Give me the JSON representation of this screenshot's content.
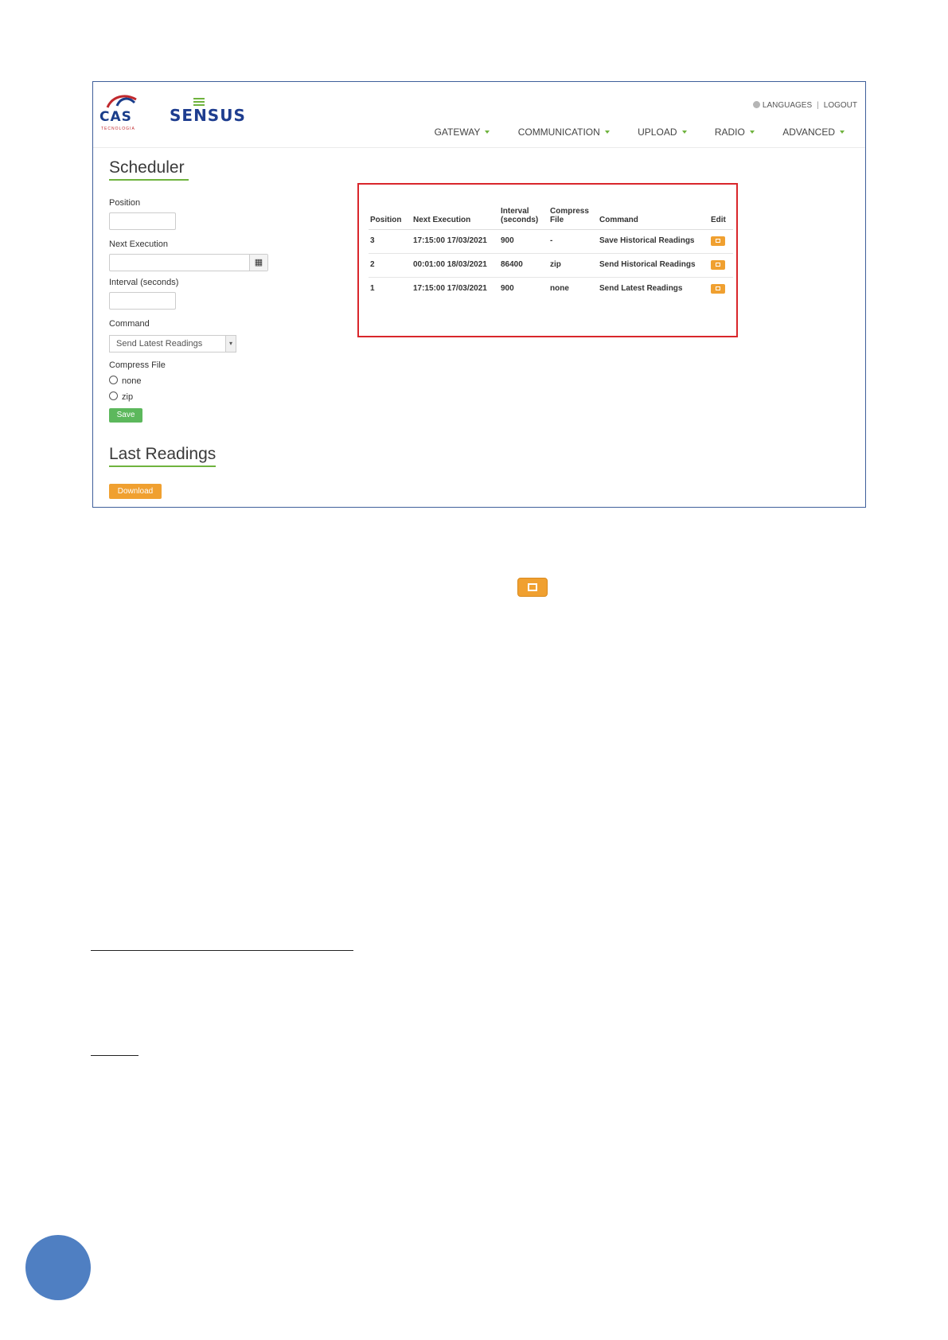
{
  "header": {
    "brand_cas": "CAS",
    "brand_cas_sub": "TECNOLOGIA",
    "brand_sensus": "SENSUS",
    "languages": "LANGUAGES",
    "logout": "LOGOUT",
    "nav": [
      "GATEWAY",
      "COMMUNICATION",
      "UPLOAD",
      "RADIO",
      "ADVANCED"
    ]
  },
  "scheduler": {
    "title": "Scheduler",
    "position_label": "Position",
    "next_execution_label": "Next Execution",
    "interval_label": "Interval (seconds)",
    "command_label": "Command",
    "command_value": "Send Latest Readings",
    "compress_label": "Compress File",
    "compress_options": [
      "none",
      "zip"
    ],
    "save_label": "Save"
  },
  "last_readings": {
    "title": "Last Readings",
    "download_label": "Download"
  },
  "table": {
    "headers": [
      "Position",
      "Next Execution",
      "Interval (seconds)",
      "Compress File",
      "Command",
      "Edit"
    ],
    "rows": [
      {
        "position": "3",
        "next": "17:15:00 17/03/2021",
        "interval": "900",
        "compress": "-",
        "command": "Save Historical Readings"
      },
      {
        "position": "2",
        "next": "00:01:00 18/03/2021",
        "interval": "86400",
        "compress": "zip",
        "command": "Send Historical Readings"
      },
      {
        "position": "1",
        "next": "17:15:00 17/03/2021",
        "interval": "900",
        "compress": "none",
        "command": "Send Latest Readings"
      }
    ]
  },
  "colors": {
    "accent_green": "#6fb33e",
    "highlight_red": "#d9262b",
    "edit_orange": "#f0a030",
    "page_circle": "#4f7fc2"
  }
}
